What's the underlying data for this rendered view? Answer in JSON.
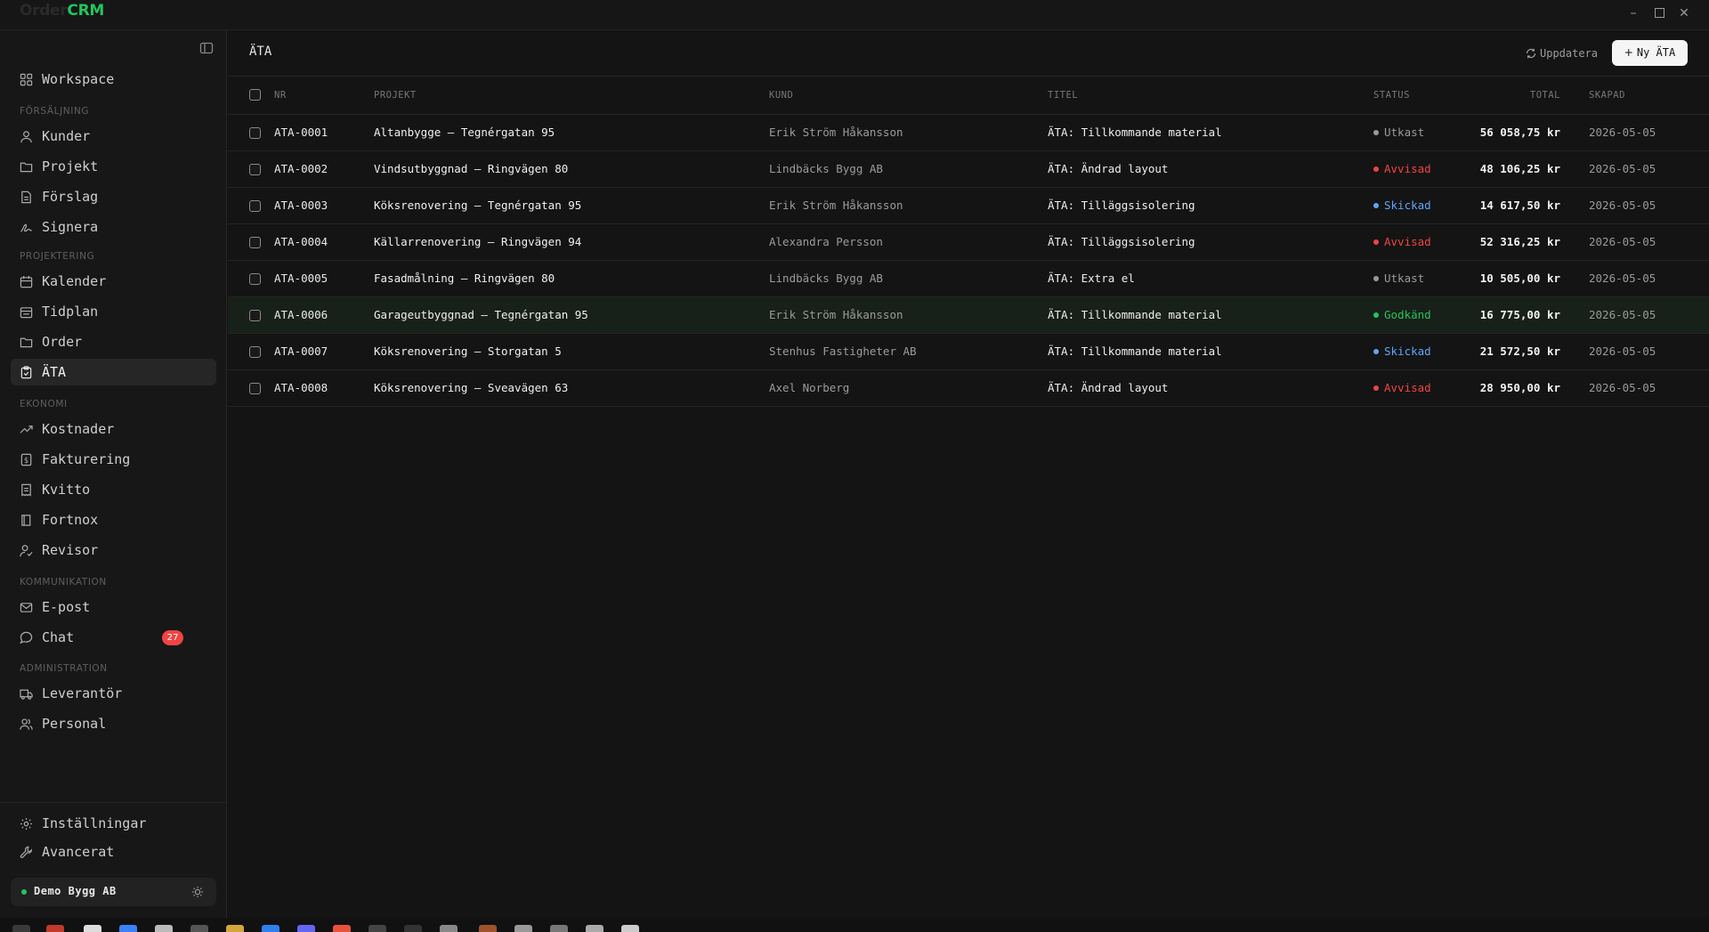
{
  "app": {
    "logo_prefix": "Order",
    "logo_suffix": "CRM"
  },
  "sidebar": {
    "workspace": "Workspace",
    "sections": {
      "sales": "FÖRSÄLJNING",
      "planning": "PROJEKTERING",
      "economy": "EKONOMI",
      "communication": "KOMMUNIKATION",
      "admin": "ADMINISTRATION"
    },
    "items": {
      "kunder": "Kunder",
      "projekt": "Projekt",
      "forslag": "Förslag",
      "signera": "Signera",
      "kalender": "Kalender",
      "tidplan": "Tidplan",
      "order": "Order",
      "ata": "ÄTA",
      "kostnader": "Kostnader",
      "fakturering": "Fakturering",
      "kvitto": "Kvitto",
      "fortnox": "Fortnox",
      "revisor": "Revisor",
      "epost": "E-post",
      "chat": "Chat",
      "chat_badge": "27",
      "leverantor": "Leverantör",
      "personal": "Personal",
      "installningar": "Inställningar",
      "avancerat": "Avancerat"
    },
    "company": "Demo Bygg AB"
  },
  "main": {
    "title": "ÄTA",
    "refresh_label": "Uppdatera",
    "new_label": "Ny ÄTA",
    "columns": {
      "nr": "NR",
      "projekt": "PROJEKT",
      "kund": "KUND",
      "titel": "TITEL",
      "status": "STATUS",
      "total": "TOTAL",
      "skapad": "SKAPAD"
    },
    "rows": [
      {
        "nr": "ATA-0001",
        "projekt": "Altanbygge – Tegnérgatan 95",
        "kund": "Erik Ström Håkansson",
        "titel": "ÄTA: Tillkommande material",
        "status": "Utkast",
        "total": "56 058,75 kr",
        "skapad": "2026-05-05"
      },
      {
        "nr": "ATA-0002",
        "projekt": "Vindsutbyggnad – Ringvägen 80",
        "kund": "Lindbäcks Bygg AB",
        "titel": "ÄTA: Ändrad layout",
        "status": "Avvisad",
        "total": "48 106,25 kr",
        "skapad": "2026-05-05"
      },
      {
        "nr": "ATA-0003",
        "projekt": "Köksrenovering – Tegnérgatan 95",
        "kund": "Erik Ström Håkansson",
        "titel": "ÄTA: Tilläggsisolering",
        "status": "Skickad",
        "total": "14 617,50 kr",
        "skapad": "2026-05-05"
      },
      {
        "nr": "ATA-0004",
        "projekt": "Källarrenovering – Ringvägen 94",
        "kund": "Alexandra Persson",
        "titel": "ÄTA: Tilläggsisolering",
        "status": "Avvisad",
        "total": "52 316,25 kr",
        "skapad": "2026-05-05"
      },
      {
        "nr": "ATA-0005",
        "projekt": "Fasadmålning – Ringvägen 80",
        "kund": "Lindbäcks Bygg AB",
        "titel": "ÄTA: Extra el",
        "status": "Utkast",
        "total": "10 505,00 kr",
        "skapad": "2026-05-05"
      },
      {
        "nr": "ATA-0006",
        "projekt": "Garageutbyggnad – Tegnérgatan 95",
        "kund": "Erik Ström Håkansson",
        "titel": "ÄTA: Tillkommande material",
        "status": "Godkänd",
        "total": "16 775,00 kr",
        "skapad": "2026-05-05"
      },
      {
        "nr": "ATA-0007",
        "projekt": "Köksrenovering – Storgatan 5",
        "kund": "Stenhus Fastigheter AB",
        "titel": "ÄTA: Tillkommande material",
        "status": "Skickad",
        "total": "21 572,50 kr",
        "skapad": "2026-05-05"
      },
      {
        "nr": "ATA-0008",
        "projekt": "Köksrenovering – Sveavägen 63",
        "kund": "Axel Norberg",
        "titel": "ÄTA: Ändrad layout",
        "status": "Avvisad",
        "total": "28 950,00 kr",
        "skapad": "2026-05-05"
      }
    ]
  },
  "status_colors": {
    "Utkast": "#9a9a9a",
    "Avvisad": "#ef4444",
    "Skickad": "#60a5fa",
    "Godkänd": "#22c55e"
  },
  "colors": {
    "accent": "#22c55e",
    "badge": "#ef4444"
  }
}
